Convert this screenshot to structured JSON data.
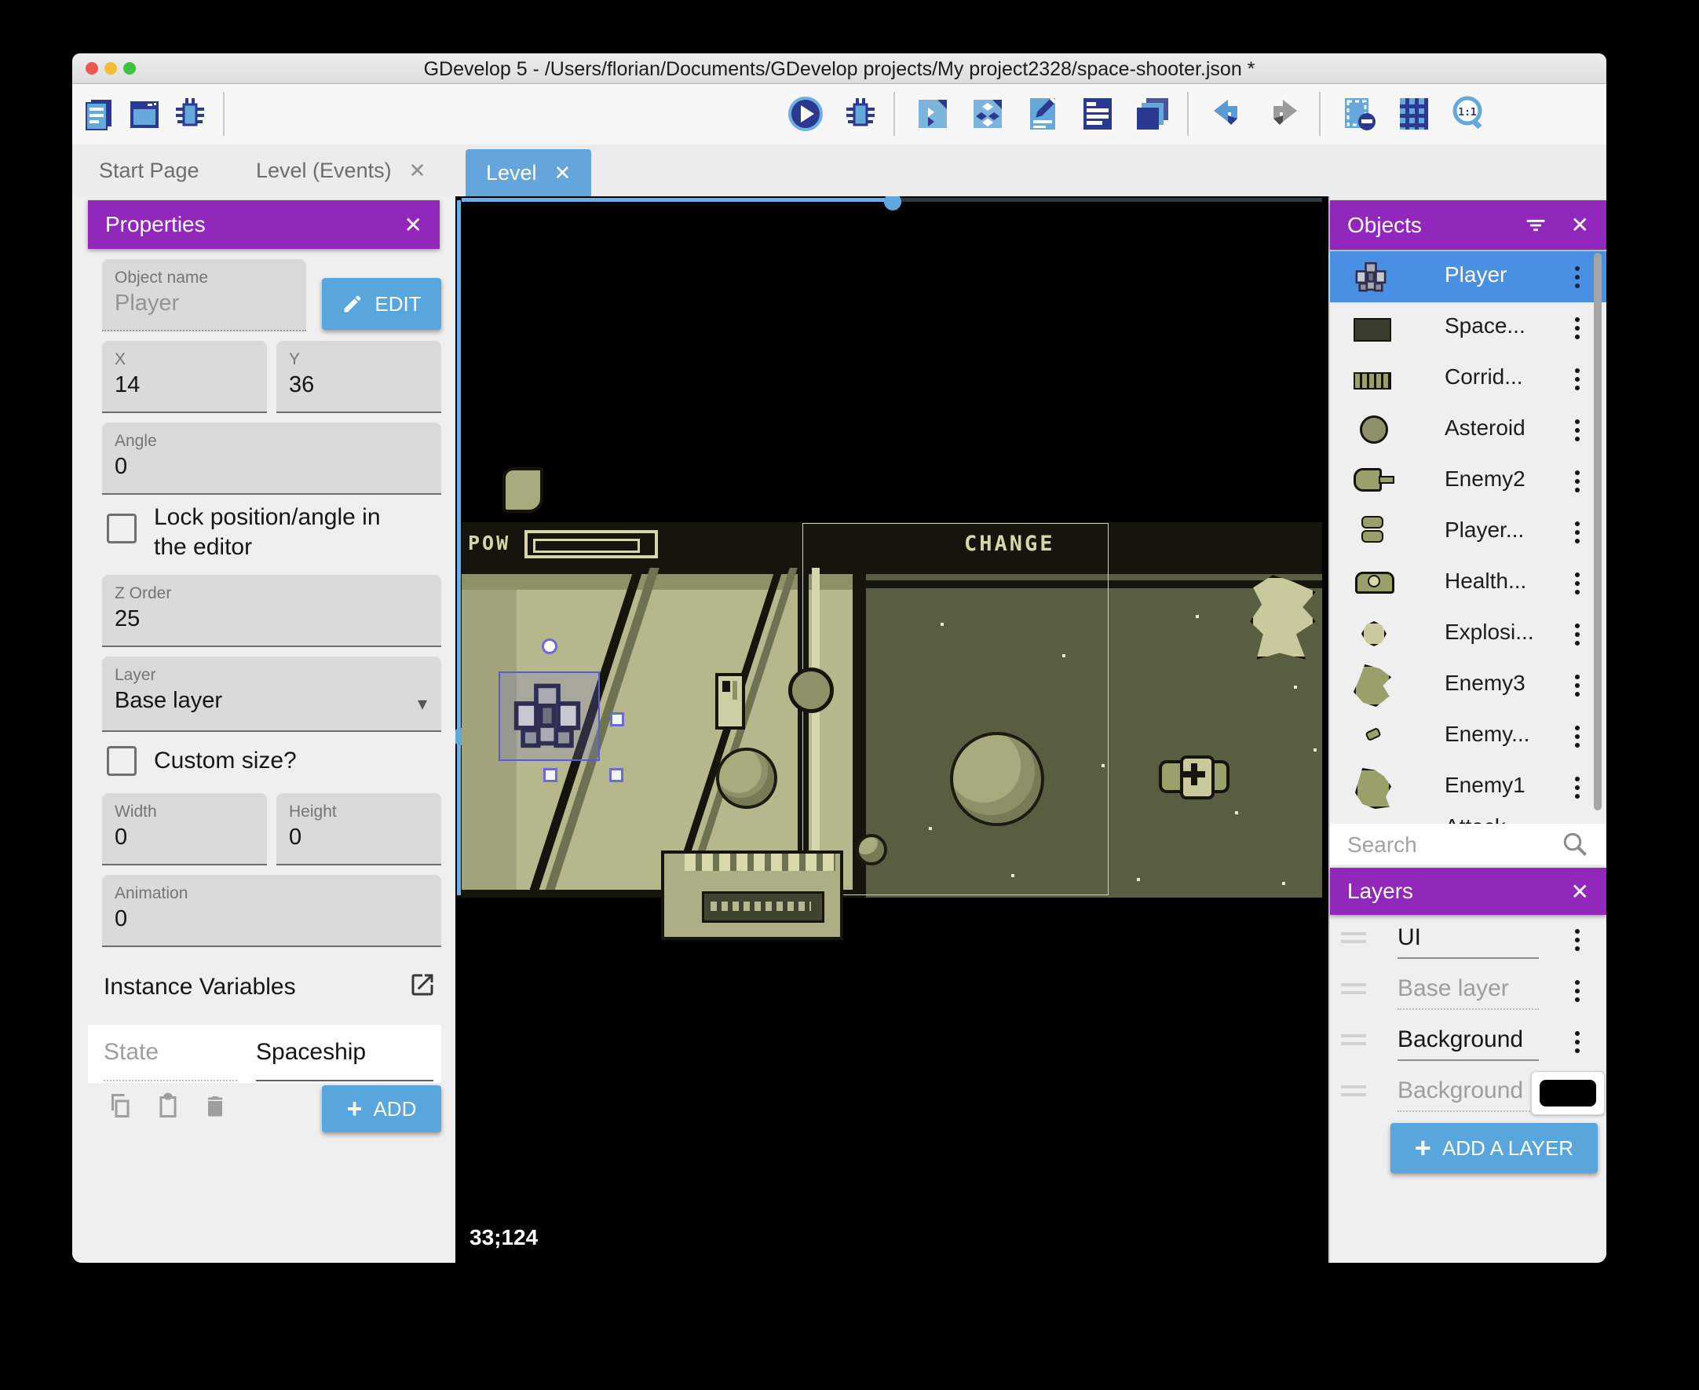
{
  "window": {
    "title": "GDevelop 5 - /Users/florian/Documents/GDevelop projects/My project2328/space-shooter.json *"
  },
  "glyphs": {
    "close": "✕",
    "caret": "▾",
    "plus": "+"
  },
  "tabs": {
    "start_page": "Start Page",
    "level_events": "Level (Events)",
    "level": "Level"
  },
  "properties": {
    "title": "Properties",
    "object_name": {
      "label": "Object name",
      "value": "Player"
    },
    "edit_button": "EDIT",
    "x": {
      "label": "X",
      "value": "14"
    },
    "y": {
      "label": "Y",
      "value": "36"
    },
    "angle": {
      "label": "Angle",
      "value": "0"
    },
    "lock_label_line1": "Lock position/angle in",
    "lock_label_line2": "the editor",
    "z_order": {
      "label": "Z Order",
      "value": "25"
    },
    "layer": {
      "label": "Layer",
      "value": "Base layer"
    },
    "custom_size_label": "Custom size?",
    "width": {
      "label": "Width",
      "value": "0"
    },
    "height": {
      "label": "Height",
      "value": "0"
    },
    "animation": {
      "label": "Animation",
      "value": "0"
    },
    "instance_variables_title": "Instance Variables",
    "variable": {
      "name": "State",
      "value": "Spaceship"
    },
    "add_button": "ADD"
  },
  "canvas": {
    "hud_pow": "POW",
    "hud_change": "CHANGE",
    "status_coordinates": "33;124"
  },
  "objects_panel": {
    "title": "Objects",
    "search_placeholder": "Search",
    "items": [
      {
        "label": "Player",
        "icon": "player-sprite",
        "selected": true
      },
      {
        "label": "Space...",
        "icon": "wall-sprite"
      },
      {
        "label": "Corrid...",
        "icon": "corridor-sprite"
      },
      {
        "label": "Asteroid",
        "icon": "asteroid-sprite"
      },
      {
        "label": "Enemy2",
        "icon": "enemy2-sprite"
      },
      {
        "label": "Player...",
        "icon": "player-bullet-sprite"
      },
      {
        "label": "Health...",
        "icon": "health-sprite"
      },
      {
        "label": "Explosi...",
        "icon": "explosion-sprite"
      },
      {
        "label": "Enemy3",
        "icon": "enemy3-sprite"
      },
      {
        "label": "Enemy...",
        "icon": "enemy-bullet-sprite"
      },
      {
        "label": "Enemy1",
        "icon": "enemy1-sprite"
      },
      {
        "label": "Attack...",
        "icon": "attack-sprite"
      }
    ]
  },
  "layers_panel": {
    "title": "Layers",
    "layers": [
      {
        "label": "UI"
      },
      {
        "label": "Base layer"
      },
      {
        "label": "Background"
      }
    ],
    "background_color_row": {
      "label": "Background",
      "color": "#000000"
    },
    "add_layer_button": "ADD A LAYER"
  },
  "colors": {
    "accent_purple": "#9227bc",
    "selection_blue": "#4a90e2",
    "button_blue": "#58a6dc",
    "tab_blue": "#64a6dc",
    "hud_text": "#d6d6a8",
    "canvas_black": "#000000"
  }
}
